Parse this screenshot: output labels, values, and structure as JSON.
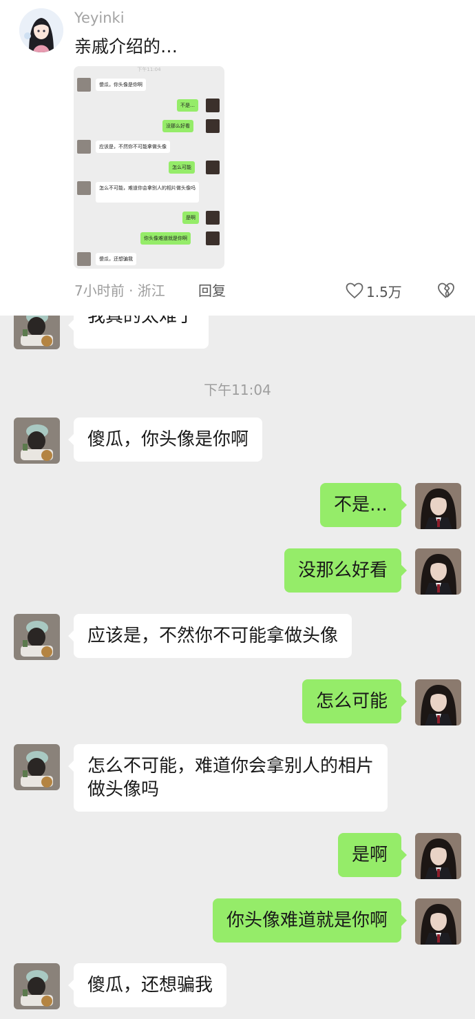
{
  "comment": {
    "username": "Yeyinki",
    "text": "亲戚介绍的…",
    "meta": "7小时前 · 浙江",
    "reply_label": "回复",
    "like_count": "1.5万",
    "thumbnail": {
      "timestamp": "下午11:04",
      "messages": [
        {
          "side": "in",
          "text": "傻瓜，你头像是你啊"
        },
        {
          "side": "out",
          "text": "不是…"
        },
        {
          "side": "out",
          "text": "没那么好看"
        },
        {
          "side": "in",
          "text": "应该是，不然你不可能拿做头像"
        },
        {
          "side": "out",
          "text": "怎么可能"
        },
        {
          "side": "in",
          "text": "怎么不可能，难道你会拿别人的相片做头像吗"
        },
        {
          "side": "out",
          "text": "是啊"
        },
        {
          "side": "out",
          "text": "你头像难道就是你啊"
        },
        {
          "side": "in",
          "text": "傻瓜，还想骗我"
        }
      ]
    }
  },
  "chat": {
    "timestamp": "下午11:04",
    "messages": [
      {
        "side": "in",
        "text": "我真的太难了"
      },
      {
        "side": "in",
        "text": "傻瓜，你头像是你啊"
      },
      {
        "side": "out",
        "text": "不是…"
      },
      {
        "side": "out",
        "text": "没那么好看"
      },
      {
        "side": "in",
        "text": "应该是，不然你不可能拿做头像"
      },
      {
        "side": "out",
        "text": "怎么可能"
      },
      {
        "side": "in",
        "line1": "怎么不可能，难道你会拿别人的相片",
        "line2": "做头像吗"
      },
      {
        "side": "out",
        "text": "是啊"
      },
      {
        "side": "out",
        "text": "你头像难道就是你啊"
      },
      {
        "side": "in",
        "text": "傻瓜，还想骗我"
      }
    ]
  },
  "colors": {
    "chat_background": "#ededed",
    "outgoing_bubble": "#95ec69",
    "incoming_bubble": "#ffffff"
  }
}
